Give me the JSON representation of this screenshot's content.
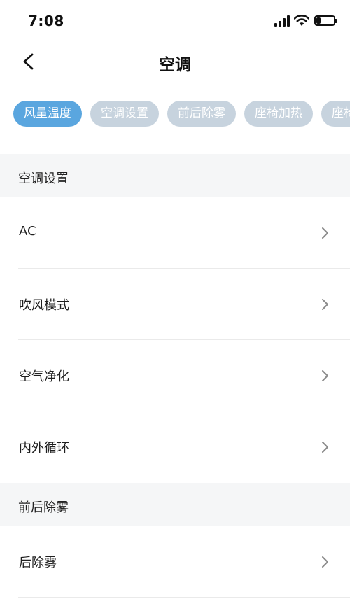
{
  "status_bar": {
    "time": "7:08"
  },
  "nav": {
    "title": "空调"
  },
  "tabs": [
    {
      "label": "风量温度",
      "active": true
    },
    {
      "label": "空调设置",
      "active": false
    },
    {
      "label": "前后除雾",
      "active": false
    },
    {
      "label": "座椅加热",
      "active": false
    },
    {
      "label": "座椅通风",
      "active": false
    }
  ],
  "sections": [
    {
      "title": "空调设置",
      "items": [
        {
          "label": "AC"
        },
        {
          "label": "吹风模式"
        },
        {
          "label": "空气净化"
        },
        {
          "label": "内外循环"
        }
      ]
    },
    {
      "title": "前后除雾",
      "items": [
        {
          "label": "后除雾"
        }
      ]
    }
  ],
  "icons": {
    "back": "chevron-left-icon",
    "row_arrow": "chevron-right-icon",
    "signal": "cellular-signal-icon",
    "wifi": "wifi-icon",
    "battery": "battery-icon"
  },
  "colors": {
    "tab_active": "#5aa6df",
    "tab_inactive": "#c7d3de",
    "section_bg": "#f5f6f7"
  },
  "battery_level": 0.25
}
